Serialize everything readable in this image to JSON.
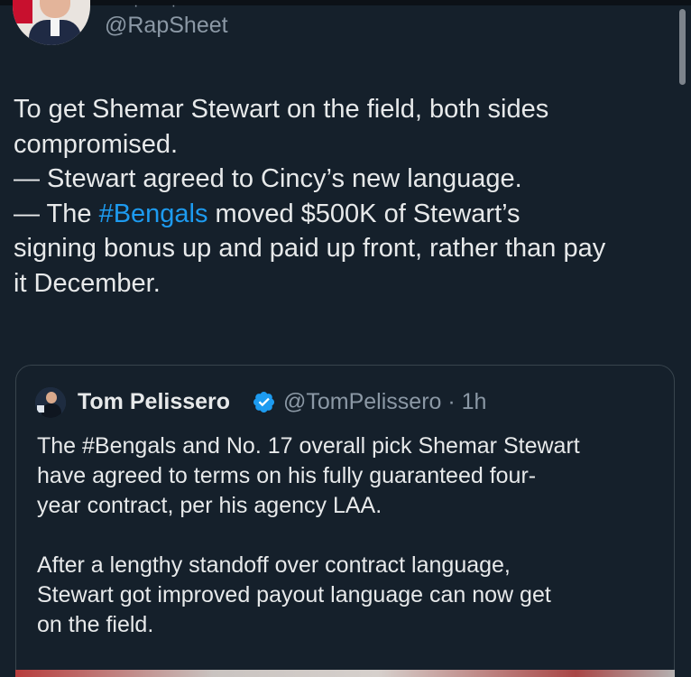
{
  "tweet": {
    "handle": "@RapSheet",
    "text_before_hashtag": "To get Shemar Stewart on the field, both sides\ncompromised.\n— Stewart agreed to Cincy’s new language.\n— The ",
    "hashtag": "#Bengals",
    "text_after_hashtag": " moved $500K of Stewart’s\nsigning bonus up and paid up front, rather than pay\nit December."
  },
  "quoted_tweet": {
    "author_name": "Tom Pelissero",
    "handle": "@TomPelissero",
    "separator": " · ",
    "time": "1h",
    "text": "The #Bengals and No. 17 overall pick Shemar Stewart\nhave agreed to terms on his fully guaranteed four-\nyear contract, per his agency LAA.\n\nAfter a lengthy standoff over contract language,\nStewart got improved payout language can now get\non the field."
  },
  "icons": {
    "verified": "verified-badge-icon",
    "avatar_main": "avatar",
    "avatar_quoted": "avatar"
  },
  "colors": {
    "background": "#15202b",
    "text": "#e7e9ea",
    "secondary": "#8b98a5",
    "accent": "#1d9bf0",
    "border": "#38444d"
  }
}
